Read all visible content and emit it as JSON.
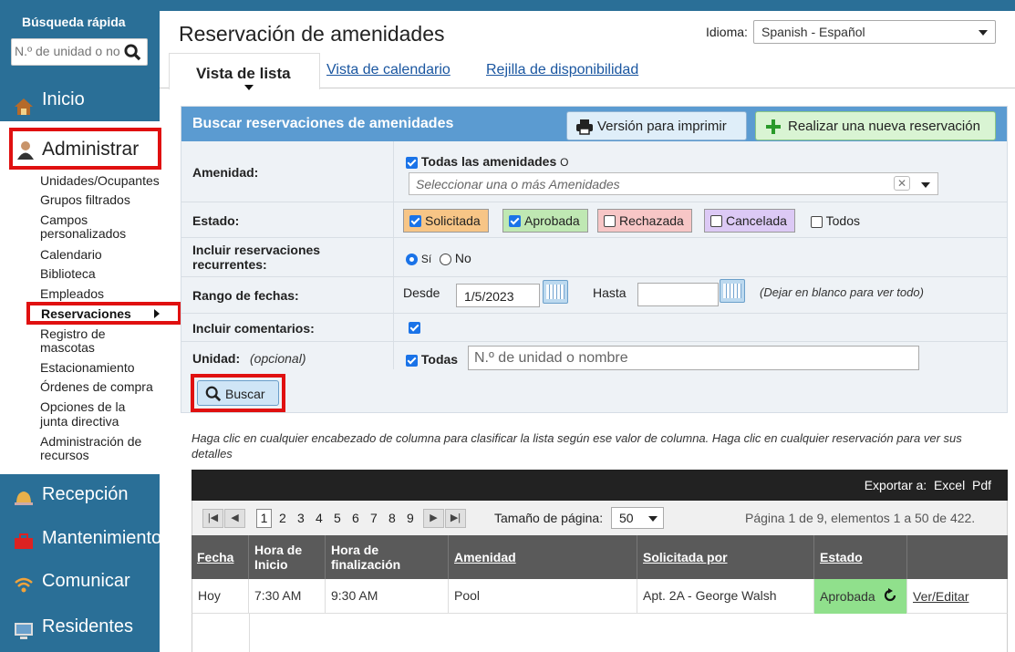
{
  "sidebar": {
    "quick_search_title": "Búsqueda rápida",
    "search_placeholder": "N.º de unidad o nombre",
    "nav_inicio": "Inicio",
    "nav_administrar": "Administrar",
    "sub": [
      "Unidades/Ocupantes",
      "Grupos filtrados",
      "Campos",
      "personalizados",
      "Calendario",
      "Biblioteca",
      "Empleados",
      "Reservaciones",
      "Registro de",
      "mascotas",
      "Estacionamiento",
      "Órdenes de compra",
      "Opciones de la",
      "junta directiva",
      "Administración de",
      "recursos"
    ],
    "nav_recepcion": "Recepción",
    "nav_mantenimiento": "Mantenimiento",
    "nav_comunicar": "Comunicar",
    "nav_residentes": "Residentes"
  },
  "header": {
    "title": "Reservación de amenidades",
    "lang_label": "Idioma:",
    "lang_value": "Spanish - Español"
  },
  "tabs": {
    "list": "Vista de lista",
    "calendar": "Vista de calendario",
    "grid": "Rejilla de disponibilidad"
  },
  "panel": {
    "title": "Buscar reservaciones de amenidades",
    "print_btn": "Versión para imprimir",
    "new_btn": "Realizar una nueva reservación",
    "amenity_label": "Amenidad:",
    "all_amenities": "Todas las amenidades",
    "all_amenities_suffix": "O",
    "amenity_placeholder": "Seleccionar una o más Amenidades",
    "status_label": "Estado:",
    "statuses": [
      "Solicitada",
      "Aprobada",
      "Rechazada",
      "Cancelada",
      "Todos"
    ],
    "recurring_label_1": "Incluir reservaciones",
    "recurring_label_2": "recurrentes:",
    "yes": "Sí",
    "no": "No",
    "date_label": "Rango de fechas:",
    "from_label": "Desde",
    "from_value": "1/5/2023",
    "to_label": "Hasta",
    "to_value": "",
    "date_hint": "(Dejar en blanco para ver todo)",
    "comments_label": "Incluir comentarios:",
    "unit_label": "Unidad:",
    "unit_optional": "(opcional)",
    "unit_all": "Todas",
    "unit_placeholder": "N.º de unidad o nombre",
    "search_btn": "Buscar"
  },
  "hint": "Haga clic en cualquier encabezado de columna para clasificar la lista según ese valor de columna. Haga clic en cualquier reservación para ver sus detalles",
  "grid": {
    "export_label": "Exportar a:",
    "export_excel": "Excel",
    "export_pdf": "Pdf",
    "pages": [
      "1",
      "2",
      "3",
      "4",
      "5",
      "6",
      "7",
      "8",
      "9"
    ],
    "page_size_label": "Tamaño de página:",
    "page_size": "50",
    "page_info": "Página 1 de 9, elementos 1 a 50 de 422.",
    "columns": [
      "Fecha",
      "Hora de Inicio",
      "Hora de finalización",
      "Amenidad",
      "Solicitada por",
      "Estado"
    ],
    "col_start_1": "Hora de",
    "col_start_2": "Inicio",
    "col_end_1": "Hora de",
    "col_end_2": "finalización",
    "rows": [
      {
        "fecha": "Hoy",
        "inicio": "7:30 AM",
        "fin": "9:30 AM",
        "amenidad": "Pool",
        "solicitada": "Apt. 2A - George Walsh",
        "estado": "Aprobada",
        "action": "Ver/Editar"
      }
    ]
  },
  "colors": {
    "sidebar_blue": "#2a6f97",
    "panel_header": "#5b9bd1",
    "highlight_red": "#e01010",
    "approved_green": "#90e08c"
  }
}
